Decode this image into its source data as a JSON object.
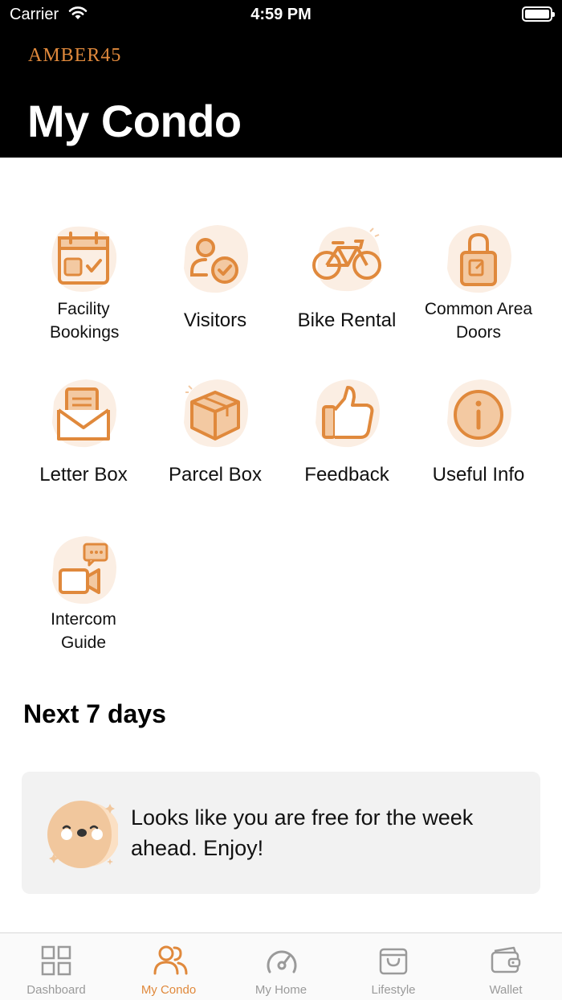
{
  "status_bar": {
    "carrier": "Carrier",
    "time": "4:59 PM"
  },
  "header": {
    "logo": "AMBER45",
    "title": "My Condo"
  },
  "tiles": [
    {
      "label": "Facility Bookings",
      "icon": "calendar-check-icon"
    },
    {
      "label": "Visitors",
      "icon": "visitor-check-icon"
    },
    {
      "label": "Bike Rental",
      "icon": "bicycle-icon"
    },
    {
      "label": "Common Area Doors",
      "icon": "padlock-icon"
    },
    {
      "label": "Letter Box",
      "icon": "envelope-letter-icon"
    },
    {
      "label": "Parcel Box",
      "icon": "parcel-box-icon"
    },
    {
      "label": "Feedback",
      "icon": "thumbs-up-icon"
    },
    {
      "label": "Useful Info",
      "icon": "info-circle-icon"
    },
    {
      "label": "Intercom Guide",
      "icon": "video-chat-icon"
    }
  ],
  "next7": {
    "title": "Next 7 days",
    "empty_message": "Looks like you are free for the week ahead. Enjoy!"
  },
  "tabbar": {
    "items": [
      {
        "label": "Dashboard",
        "icon": "grid-icon",
        "active": false
      },
      {
        "label": "My Condo",
        "icon": "people-icon",
        "active": true
      },
      {
        "label": "My Home",
        "icon": "gauge-icon",
        "active": false
      },
      {
        "label": "Lifestyle",
        "icon": "shopping-bag-icon",
        "active": false
      },
      {
        "label": "Wallet",
        "icon": "wallet-icon",
        "active": false
      }
    ]
  },
  "colors": {
    "accent": "#e0893c",
    "accent_light": "#fbeee3",
    "header_bg": "#000000",
    "card_bg": "#f2f2f2"
  }
}
